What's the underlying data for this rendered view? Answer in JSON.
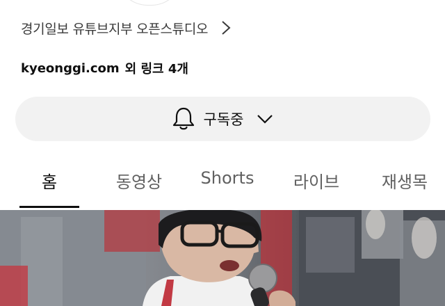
{
  "channel": {
    "studio_link_label": "경기일보 유튜브지부 오픈스튜디오",
    "links_domain": "kyeonggi.com",
    "links_more": "외 링크 4개"
  },
  "subscribe": {
    "label": "구독중"
  },
  "tabs": [
    {
      "label": "홈",
      "active": true
    },
    {
      "label": "동영상",
      "active": false
    },
    {
      "label": "Shorts",
      "active": false
    },
    {
      "label": "라이브",
      "active": false
    },
    {
      "label": "재생목",
      "active": false
    }
  ],
  "icons": {
    "studio_chevron": "chevron-right-icon",
    "bell": "bell-icon",
    "subscribe_chevron": "chevron-down-icon"
  },
  "colors": {
    "text_primary": "#0f0f0f",
    "text_secondary": "#606060",
    "button_bg": "#f2f2f2",
    "thumbnail_accent_red": "#b8343c"
  }
}
